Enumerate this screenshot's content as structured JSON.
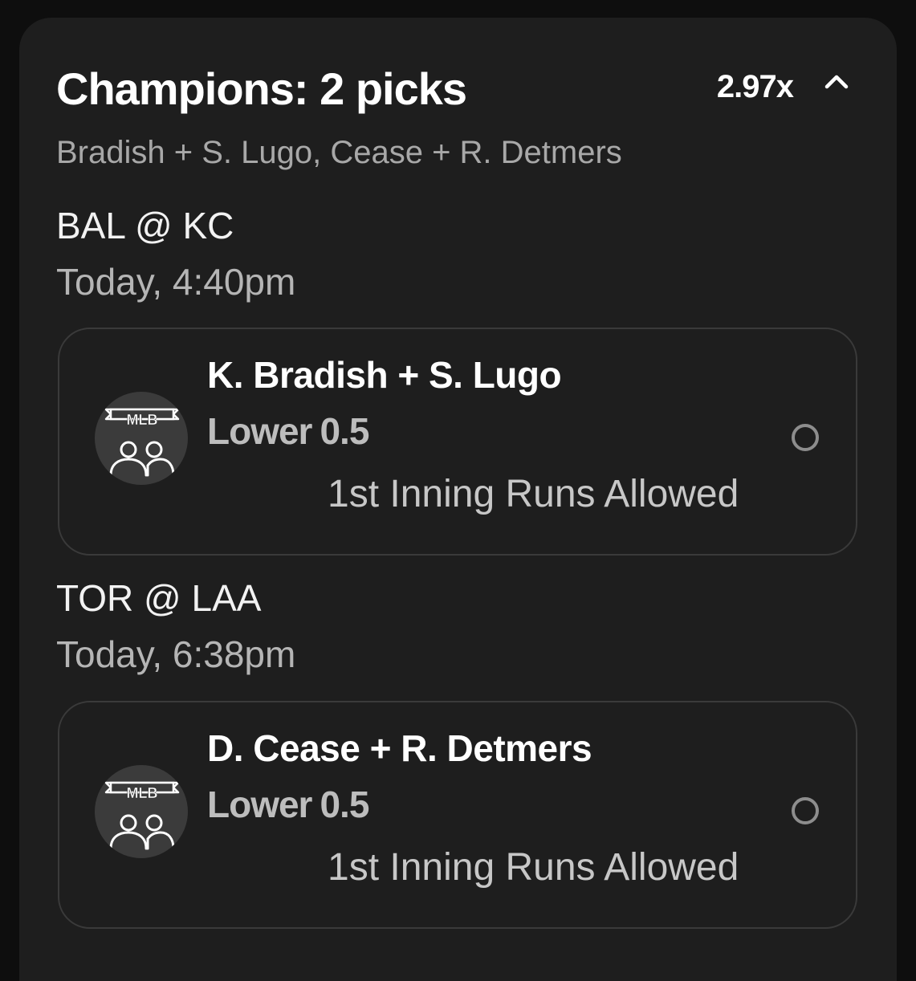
{
  "header": {
    "title": "Champions: 2 picks",
    "multiplier": "2.97x",
    "subtitle": "Bradish + S. Lugo, Cease + R. Detmers",
    "collapse_icon": "chevron-up-icon"
  },
  "games": [
    {
      "matchup": "BAL @ KC",
      "time": "Today, 4:40pm",
      "pick": {
        "league_badge": "MLB",
        "icon": "mlb-combo-players-icon",
        "players": "K. Bradish + S. Lugo",
        "direction": "Lower",
        "line": "0.5",
        "stat": "1st Inning Runs Allowed"
      }
    },
    {
      "matchup": "TOR @ LAA",
      "time": "Today, 6:38pm",
      "pick": {
        "league_badge": "MLB",
        "icon": "mlb-combo-players-icon",
        "players": "D. Cease + R. Detmers",
        "direction": "Lower",
        "line": "0.5",
        "stat": "1st Inning Runs Allowed"
      }
    }
  ]
}
